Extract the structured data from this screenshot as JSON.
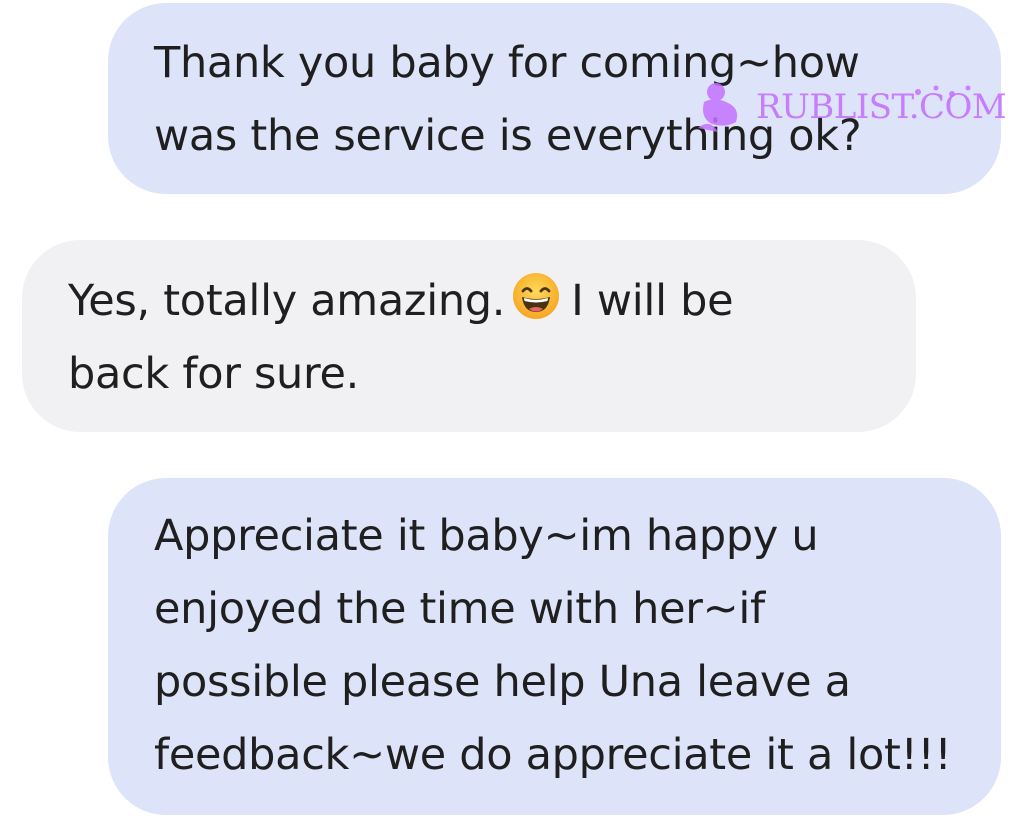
{
  "conversation": {
    "messages": [
      {
        "sender": "outgoing",
        "text": "Thank you baby for coming~how\nwas the service is everything ok?"
      },
      {
        "sender": "incoming",
        "text_before_emoji": "Yes, totally amazing.",
        "emoji": "grinning-face-with-smiling-eyes-icon",
        "text_after_emoji": "I will be\nback for sure."
      },
      {
        "sender": "outgoing",
        "text": "Appreciate it baby~im happy u\nenjoyed the time with her~if\npossible please help Una leave a\nfeedback~we do appreciate it a lot!!!"
      }
    ]
  },
  "watermark": {
    "text": "RUBLIST.COM",
    "color": "#c472ff"
  },
  "colors": {
    "outgoing_bubble": "#dde3f8",
    "incoming_bubble": "#f1f1f4",
    "text": "#1f1f1f",
    "background": "#ffffff"
  }
}
